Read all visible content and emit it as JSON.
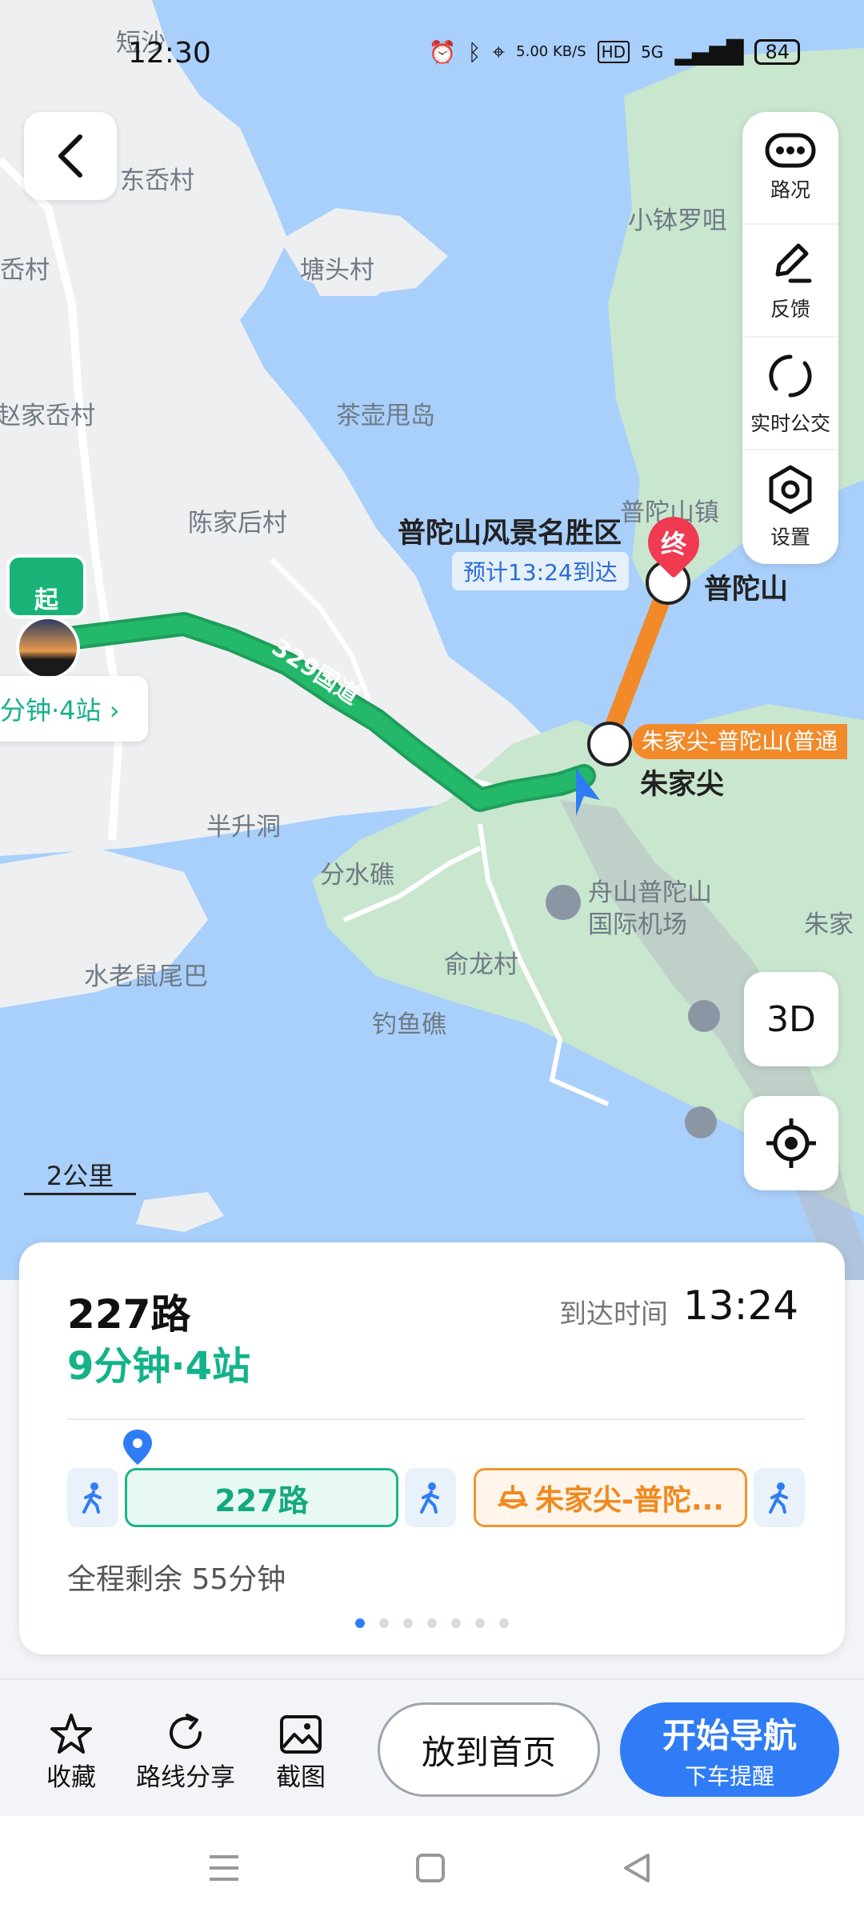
{
  "status_bar": {
    "time": "12:30",
    "net_speed": "5.00 KB/S",
    "hd": "HD",
    "signal": "5G",
    "battery": "84"
  },
  "map": {
    "places": [
      "短沙",
      "东岙村",
      "岙村",
      "塘头村",
      "小钵罗咀",
      "赵家岙村",
      "茶壶甩岛",
      "陈家后村",
      "普陀山镇",
      "半升洞",
      "分水礁",
      "舟山普陀山",
      "国际机场",
      "朱家",
      "俞龙村",
      "水老鼠尾巴",
      "钓鱼礁",
      "朱家尖",
      "普陀山",
      "普陀山风景名胜区"
    ],
    "road_label": "329国道",
    "eta_tag": "预计13:24到达",
    "ferry_label": "朱家尖-普陀山(普通",
    "end_marker": "终",
    "start_marker": "起",
    "stop_pill": "分钟·4站 ›",
    "scale": "2公里"
  },
  "tools": {
    "traffic": "路况",
    "feedback": "反馈",
    "realtime_bus": "实时公交",
    "settings": "设置"
  },
  "view_3d": "3D",
  "card": {
    "route_name": "227路",
    "route_sub": "9分钟·4站",
    "arrive_label": "到达时间",
    "arrive_time": "13:24",
    "bus_segment": "227路",
    "ferry_segment": "朱家尖-普陀...",
    "remaining": "全程剩余 55分钟",
    "page_count": 7,
    "active_page": 0
  },
  "actions": {
    "favorite": "收藏",
    "share": "路线分享",
    "screenshot": "截图",
    "home": "放到首页",
    "navigate": "开始导航",
    "navigate_sub": "下车提醒"
  },
  "colors": {
    "accent": "#2f7cf6",
    "bus_green": "#14b38a",
    "ferry_orange": "#f1952f",
    "end_red": "#ef3a52",
    "water": "#a9cffb",
    "land": "#eeeff1",
    "island_green": "#c9e6cf"
  }
}
